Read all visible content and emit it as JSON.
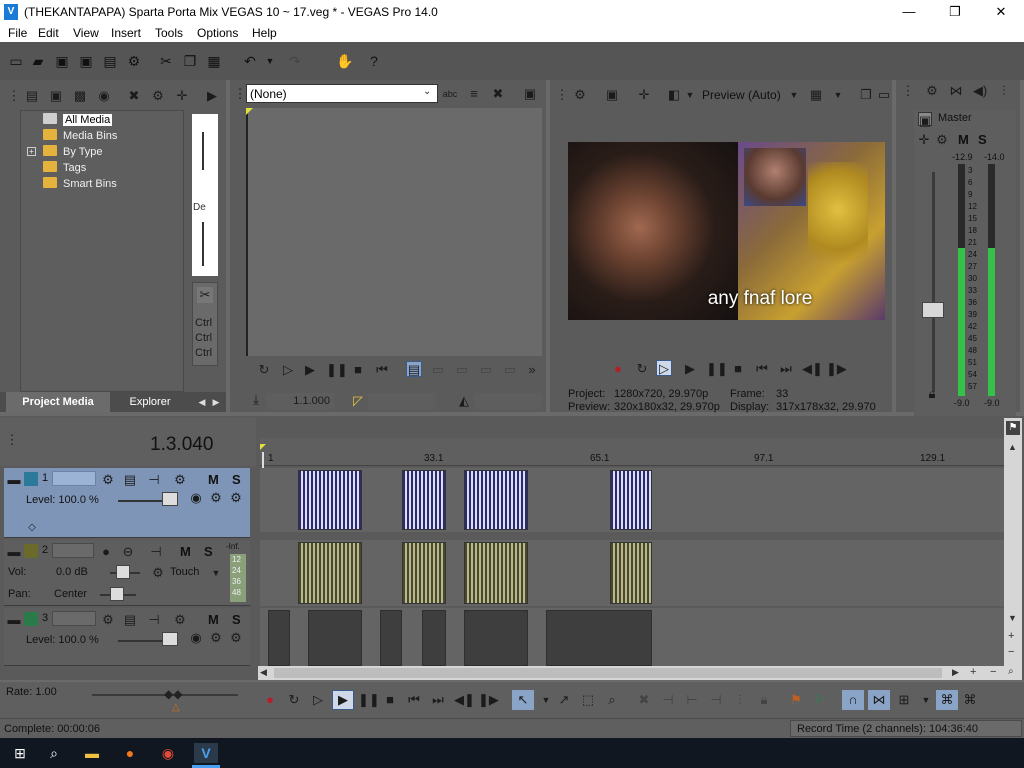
{
  "window": {
    "title": "(THEKANTAPAPA) Sparta Porta Mix VEGAS 10 ~ 17.veg * - VEGAS Pro 14.0",
    "minimize": "—",
    "maximize": "❐",
    "close": "✕"
  },
  "menu": [
    "File",
    "Edit",
    "View",
    "Insert",
    "Tools",
    "Options",
    "Help"
  ],
  "project_media": {
    "tree": [
      "All Media",
      "Media Bins",
      "By Type",
      "Tags",
      "Smart Bins"
    ],
    "tabs": [
      "Project Media",
      "Explorer"
    ],
    "ctrl_labels": [
      "Ctrl",
      "Ctrl",
      "Ctrl"
    ],
    "de_label": "De"
  },
  "trimmer": {
    "dropdown_value": "(None)",
    "timecode": "1.1.000"
  },
  "preview": {
    "mode": "Preview (Auto)",
    "caption": "any fnaf lore",
    "project_label": "Project:",
    "project_value": "1280x720, 29.970p",
    "preview_label": "Preview:",
    "preview_value": "320x180x32, 29.970p",
    "frame_label": "Frame:",
    "frame_value": "33",
    "display_label": "Display:",
    "display_value": "317x178x32, 29.970"
  },
  "master": {
    "title": "Master",
    "m": "M",
    "s": "S",
    "peak_left": "-12.9",
    "peak_right": "-14.0",
    "scale": [
      "3",
      "6",
      "9",
      "12",
      "15",
      "18",
      "21",
      "24",
      "27",
      "30",
      "33",
      "36",
      "39",
      "42",
      "45",
      "48",
      "51",
      "54",
      "57"
    ],
    "bottom_left": "-9.0",
    "bottom_right": "-9.0",
    "level_left": 0.64,
    "level_right": 0.64
  },
  "timeline": {
    "cursor_time": "1.3.040",
    "ruler": [
      "1",
      "33.1",
      "65.1",
      "97.1",
      "129.1"
    ],
    "tracks": [
      {
        "num": "1",
        "level": "Level: 100.0 %",
        "m": "M",
        "s": "S"
      },
      {
        "num": "2",
        "vol_label": "Vol:",
        "vol_value": "0.0 dB",
        "pan_label": "Pan:",
        "pan_value": "Center",
        "automation": "Touch",
        "m": "M",
        "s": "S",
        "meter_top": "-Inf.",
        "meter_scale": [
          "12",
          "24",
          "36",
          "48"
        ]
      },
      {
        "num": "3",
        "level": "Level: 100.0 %",
        "m": "M",
        "s": "S"
      }
    ]
  },
  "transport": {
    "rate": "Rate: 1.00"
  },
  "status": {
    "complete": "Complete: 00:00:06",
    "record_time": "Record Time (2 channels): 104:36:40"
  }
}
